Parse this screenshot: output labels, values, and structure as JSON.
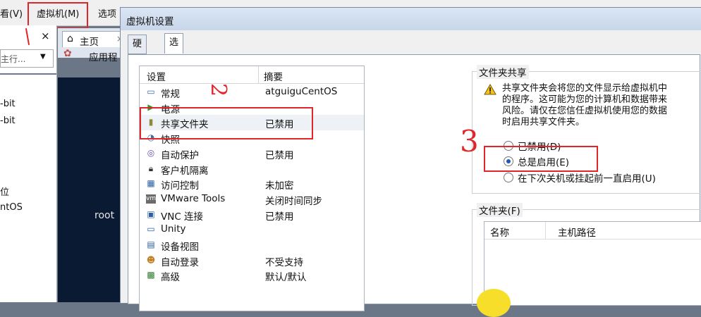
{
  "menubar": {
    "view": "看(V)",
    "vm": "虚拟机(M)",
    "options": "选项"
  },
  "leftpanel": {
    "close": "×",
    "dropdown_text": "主行...",
    "items": [
      "-bit",
      "-bit",
      "位",
      "ntOS"
    ]
  },
  "tabbar": {
    "home_tab": "主页",
    "close": "×",
    "app_tab": "应用程"
  },
  "console": {
    "user": "root"
  },
  "dialog": {
    "title": "虚拟机设置",
    "tabs": [
      "硬件",
      "选项"
    ],
    "active_tab": "选项",
    "list": {
      "col_setting": "设置",
      "col_summary": "摘要",
      "rows": [
        {
          "name": "常规",
          "summary": "atguiguCentOS",
          "icon": "general-icon"
        },
        {
          "name": "电源",
          "summary": "",
          "icon": "power-icon"
        },
        {
          "name": "共享文件夹",
          "summary": "已禁用",
          "icon": "shared-folder-icon"
        },
        {
          "name": "快照",
          "summary": "",
          "icon": "snapshot-icon"
        },
        {
          "name": "自动保护",
          "summary": "已禁用",
          "icon": "autoprotect-icon"
        },
        {
          "name": "客户机隔离",
          "summary": "",
          "icon": "lock-icon"
        },
        {
          "name": "访问控制",
          "summary": "未加密",
          "icon": "access-control-icon"
        },
        {
          "name": "VMware Tools",
          "summary": "关闭时间同步",
          "icon": "vmware-tools-icon"
        },
        {
          "name": "VNC 连接",
          "summary": "已禁用",
          "icon": "vnc-icon"
        },
        {
          "name": "Unity",
          "summary": "",
          "icon": "unity-icon"
        },
        {
          "name": "设备视图",
          "summary": "",
          "icon": "device-view-icon"
        },
        {
          "name": "自动登录",
          "summary": "不受支持",
          "icon": "autologin-icon"
        },
        {
          "name": "高级",
          "summary": "默认/默认",
          "icon": "advanced-icon"
        }
      ],
      "selected_row": "共享文件夹"
    },
    "share": {
      "legend": "文件夹共享",
      "warning_lines": [
        "共享文件夹会将您的文件显示给虚拟机中",
        "的程序。这可能为您的计算机和数据带来",
        "风险。请仅在您信任虚拟机使用您的数据",
        "时启用共享文件夹。"
      ],
      "options": [
        "已禁用(D)",
        "总是启用(E)",
        "在下次关机或挂起前一直启用(U)"
      ],
      "selected": "总是启用(E)"
    },
    "folders": {
      "legend": "文件夹(F)",
      "col_name": "名称",
      "col_host_path": "主机路径"
    }
  },
  "annotations": {
    "mark_2": "2",
    "mark_3": "3"
  },
  "colors": {
    "annotation_red": "#e0262a",
    "radio_selected": "#1b58b8"
  }
}
